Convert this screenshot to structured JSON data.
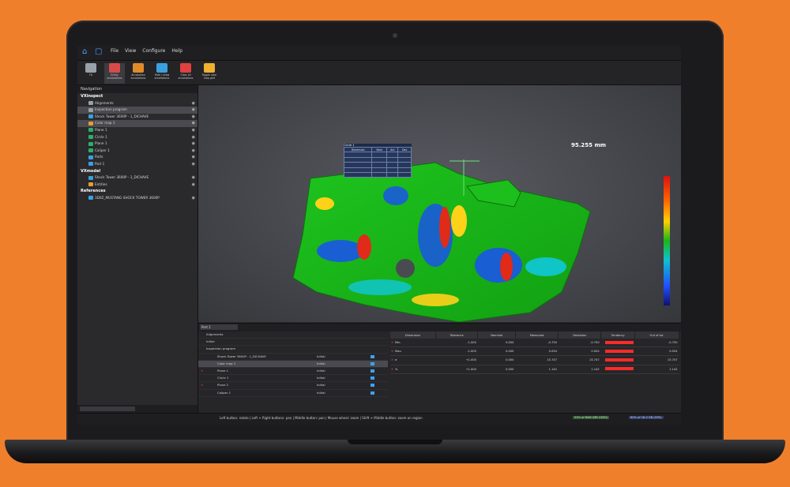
{
  "app": {
    "menu": [
      "File",
      "View",
      "Configure",
      "Help"
    ]
  },
  "ribbon": {
    "buttons": [
      {
        "label": "Fit",
        "color": "#9aa0a8"
      },
      {
        "label": "Entity annotations",
        "color": "#d84a4a"
      },
      {
        "label": "Annotation annotations",
        "color": "#e08a2a"
      },
      {
        "label": "Hide / show annotations",
        "color": "#3aa0e0"
      },
      {
        "label": "Clear all annotations",
        "color": "#e04040"
      },
      {
        "label": "Toggle color map grid",
        "color": "#f0b030"
      }
    ]
  },
  "navigation": {
    "header": "Navigation",
    "items": [
      {
        "label": "VXinspect",
        "type": "head"
      },
      {
        "label": "Alignments",
        "type": "item",
        "color": "#9aa0a8"
      },
      {
        "label": "Inspection program",
        "type": "item",
        "color": "#9aa0a8",
        "selected": true
      },
      {
        "label": "Shock Tower 3600P - 1_DICHAVE",
        "type": "item",
        "color": "#3aa0e0"
      },
      {
        "label": "Color map 1",
        "type": "item",
        "color": "#e0a030",
        "selected": true
      },
      {
        "label": "Plane 1",
        "type": "item",
        "color": "#2ab06a"
      },
      {
        "label": "Circle 1",
        "type": "item",
        "color": "#2ab06a"
      },
      {
        "label": "Plane 1",
        "type": "item",
        "color": "#2ab06a"
      },
      {
        "label": "Caliper 1",
        "type": "item",
        "color": "#2ab06a"
      },
      {
        "label": "Parts",
        "type": "item",
        "color": "#3aa0e0"
      },
      {
        "label": "Part 1",
        "type": "item",
        "color": "#3aa0e0"
      },
      {
        "label": "VXmodel",
        "type": "head"
      },
      {
        "label": "Shock Tower 3600P - 1_DICHAVE",
        "type": "item",
        "color": "#3aa0e0"
      },
      {
        "label": "Entities",
        "type": "item",
        "color": "#e0a030"
      },
      {
        "label": "References",
        "type": "head"
      },
      {
        "label": "3D0Z_MUSTANG SHOCK TOWER 3600P",
        "type": "item",
        "color": "#3aa0e0"
      }
    ]
  },
  "viewport": {
    "measurement": "95.255 mm",
    "inspection_table": {
      "title": "Circle 1",
      "rows": [
        [
          "Dimension",
          "Nom",
          "Act",
          "Dev"
        ],
        [
          "",
          "",
          "",
          ""
        ],
        [
          "",
          "",
          "",
          ""
        ],
        [
          "",
          "",
          "",
          ""
        ],
        [
          "",
          "",
          "",
          ""
        ],
        [
          "",
          "",
          "",
          ""
        ]
      ]
    }
  },
  "bottom": {
    "part_select": "Part 1",
    "rows": [
      {
        "label": "Alignments",
        "status": "",
        "error": false
      },
      {
        "label": "Initial",
        "status": "",
        "error": false
      },
      {
        "label": "Inspection program",
        "status": "",
        "error": false
      },
      {
        "label": "Shock Tower 3600P - 1_DICHAVE",
        "status": "Initial",
        "error": false
      },
      {
        "label": "Color map 1",
        "status": "Initial",
        "error": false,
        "selected": true
      },
      {
        "label": "Plane 1",
        "status": "Initial",
        "error": true
      },
      {
        "label": "Circle 1",
        "status": "Initial",
        "error": false
      },
      {
        "label": "Plane 2",
        "status": "Initial",
        "error": true
      },
      {
        "label": "Caliper 1",
        "status": "Initial",
        "error": false
      }
    ],
    "results": {
      "columns": [
        "Dimension",
        "Tolerance",
        "Nominal",
        "Measured",
        "Deviation",
        "Tendency",
        "Out of tol."
      ],
      "rows": [
        {
          "name": "Min.",
          "tol": "-1.000",
          "nom": "0.000",
          "meas": "-0.750",
          "dev": "-0.750",
          "out": "-0.750"
        },
        {
          "name": "Max.",
          "tol": "-1.000",
          "nom": "0.000",
          "meas": "0.054",
          "dev": "0.054",
          "out": "0.054"
        },
        {
          "name": "σ",
          "tol": "+1.000",
          "nom": "0.000",
          "meas": "15.747",
          "dev": "15.747",
          "out": "15.747"
        },
        {
          "name": "%",
          "tol": "+1.000",
          "nom": "0.000",
          "meas": "1.142",
          "dev": "1.142",
          "out": "1.142"
        }
      ]
    }
  },
  "statusbar": {
    "hint": "Left button: rotate | Left + Right buttons: pan | Middle button: pan | Mouse wheel: zoom | Shift + Middle button: zoom on region",
    "memory": "53% of RAM (MB USED)",
    "video": "60% of 16.0 GB (GPU)"
  }
}
